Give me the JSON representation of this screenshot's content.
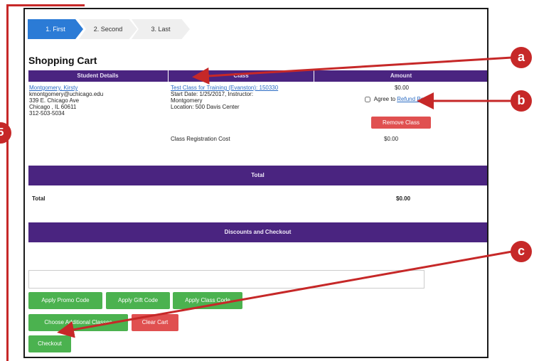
{
  "annotation": {
    "step_number": "5",
    "markers": {
      "a": "a",
      "b": "b",
      "c": "c"
    },
    "color": "#c62828"
  },
  "steps": {
    "first": "1. First",
    "second": "2. Second",
    "last": "3. Last"
  },
  "page_title": "Shopping Cart",
  "table": {
    "headers": [
      "Student Details",
      "Class",
      "Amount"
    ],
    "student": {
      "name": "Montgomery, Kirsty",
      "email": "kmontgomery@uchicago.edu",
      "address1": "339 E. Chicago Ave",
      "address2": "Chicago , IL 60611",
      "phone": "312-503-5034"
    },
    "class": {
      "name": "Test Class for Training (Evanston): 150330",
      "start_date": "Start Date: 1/25/2017, Instructor:",
      "instructor": "Montgomery",
      "location": "Location: 500 Davis Center"
    },
    "amount": "$0.00",
    "agree_prefix": "Agree to",
    "agree_link": "Refund Po",
    "remove_button": "Remove Class",
    "registration_cost_label": "Class Registration Cost",
    "registration_cost_value": "$0.00"
  },
  "totals": {
    "bar_label": "Total",
    "row_label": "Total",
    "row_value": "$0.00"
  },
  "discounts": {
    "bar_label": "Discounts and Checkout",
    "code_input_value": ""
  },
  "buttons": {
    "promo": "Apply Promo Code",
    "gift": "Apply Gift Code",
    "class_code": "Apply Class Code",
    "additional": "Choose Additional Classes",
    "clear": "Clear Cart",
    "checkout": "Checkout"
  }
}
